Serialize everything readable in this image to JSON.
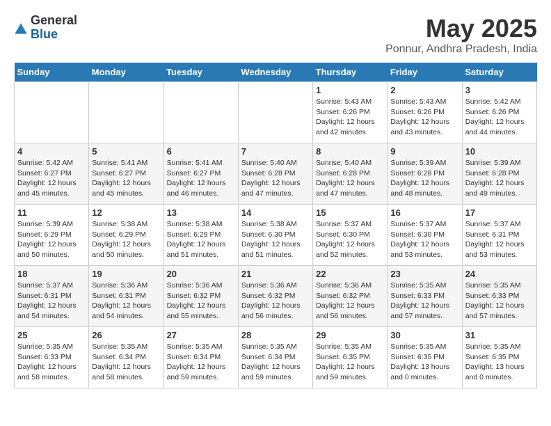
{
  "header": {
    "logo_general": "General",
    "logo_blue": "Blue",
    "month_title": "May 2025",
    "location": "Ponnur, Andhra Pradesh, India"
  },
  "weekdays": [
    "Sunday",
    "Monday",
    "Tuesday",
    "Wednesday",
    "Thursday",
    "Friday",
    "Saturday"
  ],
  "weeks": [
    [
      {
        "day": "",
        "info": ""
      },
      {
        "day": "",
        "info": ""
      },
      {
        "day": "",
        "info": ""
      },
      {
        "day": "",
        "info": ""
      },
      {
        "day": "1",
        "info": "Sunrise: 5:43 AM\nSunset: 6:26 PM\nDaylight: 12 hours\nand 42 minutes."
      },
      {
        "day": "2",
        "info": "Sunrise: 5:43 AM\nSunset: 6:26 PM\nDaylight: 12 hours\nand 43 minutes."
      },
      {
        "day": "3",
        "info": "Sunrise: 5:42 AM\nSunset: 6:26 PM\nDaylight: 12 hours\nand 44 minutes."
      }
    ],
    [
      {
        "day": "4",
        "info": "Sunrise: 5:42 AM\nSunset: 6:27 PM\nDaylight: 12 hours\nand 45 minutes."
      },
      {
        "day": "5",
        "info": "Sunrise: 5:41 AM\nSunset: 6:27 PM\nDaylight: 12 hours\nand 45 minutes."
      },
      {
        "day": "6",
        "info": "Sunrise: 5:41 AM\nSunset: 6:27 PM\nDaylight: 12 hours\nand 46 minutes."
      },
      {
        "day": "7",
        "info": "Sunrise: 5:40 AM\nSunset: 6:28 PM\nDaylight: 12 hours\nand 47 minutes."
      },
      {
        "day": "8",
        "info": "Sunrise: 5:40 AM\nSunset: 6:28 PM\nDaylight: 12 hours\nand 47 minutes."
      },
      {
        "day": "9",
        "info": "Sunrise: 5:39 AM\nSunset: 6:28 PM\nDaylight: 12 hours\nand 48 minutes."
      },
      {
        "day": "10",
        "info": "Sunrise: 5:39 AM\nSunset: 6:28 PM\nDaylight: 12 hours\nand 49 minutes."
      }
    ],
    [
      {
        "day": "11",
        "info": "Sunrise: 5:39 AM\nSunset: 6:29 PM\nDaylight: 12 hours\nand 50 minutes."
      },
      {
        "day": "12",
        "info": "Sunrise: 5:38 AM\nSunset: 6:29 PM\nDaylight: 12 hours\nand 50 minutes."
      },
      {
        "day": "13",
        "info": "Sunrise: 5:38 AM\nSunset: 6:29 PM\nDaylight: 12 hours\nand 51 minutes."
      },
      {
        "day": "14",
        "info": "Sunrise: 5:38 AM\nSunset: 6:30 PM\nDaylight: 12 hours\nand 51 minutes."
      },
      {
        "day": "15",
        "info": "Sunrise: 5:37 AM\nSunset: 6:30 PM\nDaylight: 12 hours\nand 52 minutes."
      },
      {
        "day": "16",
        "info": "Sunrise: 5:37 AM\nSunset: 6:30 PM\nDaylight: 12 hours\nand 53 minutes."
      },
      {
        "day": "17",
        "info": "Sunrise: 5:37 AM\nSunset: 6:31 PM\nDaylight: 12 hours\nand 53 minutes."
      }
    ],
    [
      {
        "day": "18",
        "info": "Sunrise: 5:37 AM\nSunset: 6:31 PM\nDaylight: 12 hours\nand 54 minutes."
      },
      {
        "day": "19",
        "info": "Sunrise: 5:36 AM\nSunset: 6:31 PM\nDaylight: 12 hours\nand 54 minutes."
      },
      {
        "day": "20",
        "info": "Sunrise: 5:36 AM\nSunset: 6:32 PM\nDaylight: 12 hours\nand 55 minutes."
      },
      {
        "day": "21",
        "info": "Sunrise: 5:36 AM\nSunset: 6:32 PM\nDaylight: 12 hours\nand 56 minutes."
      },
      {
        "day": "22",
        "info": "Sunrise: 5:36 AM\nSunset: 6:32 PM\nDaylight: 12 hours\nand 56 minutes."
      },
      {
        "day": "23",
        "info": "Sunrise: 5:35 AM\nSunset: 6:33 PM\nDaylight: 12 hours\nand 57 minutes."
      },
      {
        "day": "24",
        "info": "Sunrise: 5:35 AM\nSunset: 6:33 PM\nDaylight: 12 hours\nand 57 minutes."
      }
    ],
    [
      {
        "day": "25",
        "info": "Sunrise: 5:35 AM\nSunset: 6:33 PM\nDaylight: 12 hours\nand 58 minutes."
      },
      {
        "day": "26",
        "info": "Sunrise: 5:35 AM\nSunset: 6:34 PM\nDaylight: 12 hours\nand 58 minutes."
      },
      {
        "day": "27",
        "info": "Sunrise: 5:35 AM\nSunset: 6:34 PM\nDaylight: 12 hours\nand 59 minutes."
      },
      {
        "day": "28",
        "info": "Sunrise: 5:35 AM\nSunset: 6:34 PM\nDaylight: 12 hours\nand 59 minutes."
      },
      {
        "day": "29",
        "info": "Sunrise: 5:35 AM\nSunset: 6:35 PM\nDaylight: 12 hours\nand 59 minutes."
      },
      {
        "day": "30",
        "info": "Sunrise: 5:35 AM\nSunset: 6:35 PM\nDaylight: 13 hours\nand 0 minutes."
      },
      {
        "day": "31",
        "info": "Sunrise: 5:35 AM\nSunset: 6:35 PM\nDaylight: 13 hours\nand 0 minutes."
      }
    ]
  ]
}
